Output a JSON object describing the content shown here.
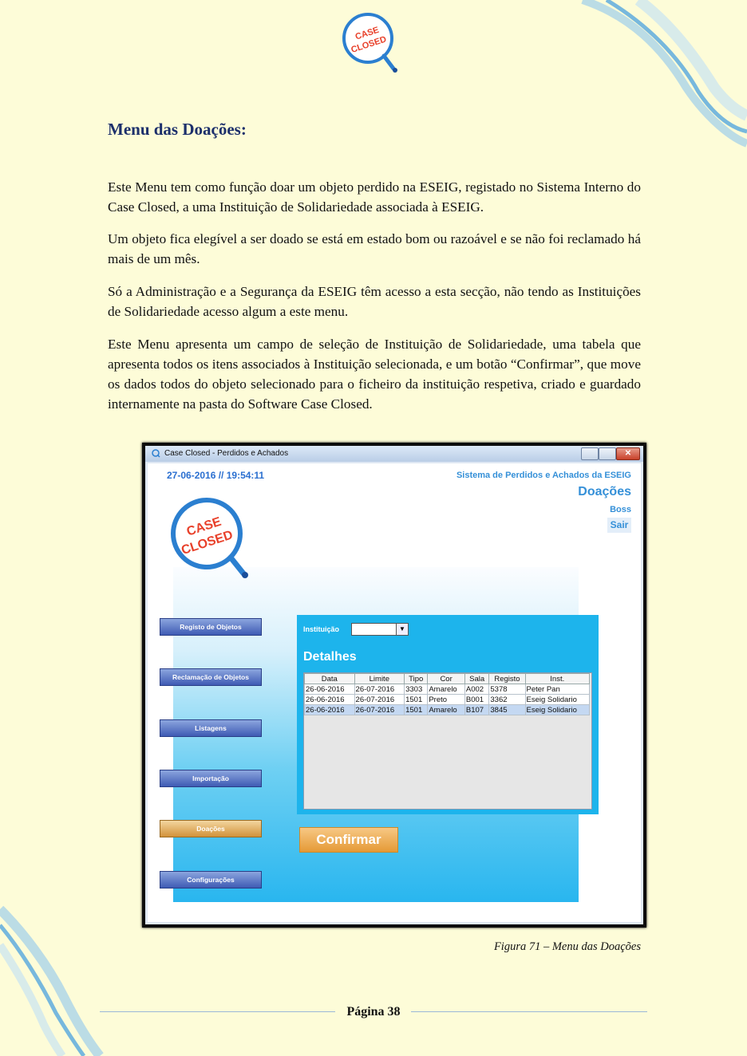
{
  "header": {
    "logo_text_line1": "CASE",
    "logo_text_line2": "CLOSED"
  },
  "section_title": "Menu das Doações:",
  "paragraphs": [
    "Este Menu tem como função doar um objeto perdido na ESEIG, registado no Sistema Interno do Case Closed, a uma Instituição de Solidariedade associada à ESEIG.",
    "Um objeto fica elegível a ser doado se está em estado bom ou razoável e se não foi reclamado há mais de um mês.",
    "Só a Administração e a Segurança da ESEIG têm acesso a esta secção, não tendo as Instituições de Solidariedade acesso algum a este menu.",
    "Este Menu apresenta um campo de seleção de Instituição de Solidariedade, uma tabela que apresenta todos os itens associados à Instituição selecionada, e um botão “Confirmar”, que move os dados todos do objeto selecionado para o ficheiro da instituição respetiva, criado e guardado internamente na pasta do Software Case Closed."
  ],
  "app": {
    "window_title": "Case Closed - Perdidos e Achados",
    "datetime": "27-06-2016 // 19:54:11",
    "system_title": "Sistema de Perdidos e Achados da ESEIG",
    "page_name": "Doações",
    "user": "Boss",
    "logout": "Sair",
    "logo_text_line1": "CASE",
    "logo_text_line2": "CLOSED",
    "menu": [
      {
        "label": "Registo de Objetos",
        "active": false
      },
      {
        "label": "Reclamação de Objetos",
        "active": false
      },
      {
        "label": "Listagens",
        "active": false
      },
      {
        "label": "Importação",
        "active": false
      },
      {
        "label": "Doações",
        "active": true
      },
      {
        "label": "Configurações",
        "active": false
      }
    ],
    "institution_label": "Instituição",
    "institution_value": "",
    "details_title": "Detalhes",
    "table": {
      "columns": [
        "Data",
        "Limite",
        "Tipo",
        "Cor",
        "Sala",
        "Registo",
        "Inst."
      ],
      "rows": [
        [
          "26-06-2016",
          "26-07-2016",
          "3303",
          "Amarelo",
          "A002",
          "5378",
          "Peter Pan"
        ],
        [
          "26-06-2016",
          "26-07-2016",
          "1501",
          "Preto",
          "B001",
          "3362",
          "Eseig Solidario"
        ],
        [
          "26-06-2016",
          "26-07-2016",
          "1501",
          "Amarelo",
          "B107",
          "3845",
          "Eseig Solidario"
        ]
      ],
      "selected_row": 2
    },
    "confirm_label": "Confirmar"
  },
  "caption": "Figura 71 – Menu das Doações",
  "footer": "Página 38",
  "colors": {
    "title": "#1c2f6b",
    "accent": "#3590d8",
    "panel": "#1db4ec",
    "page_bg": "#fdfcd8"
  }
}
